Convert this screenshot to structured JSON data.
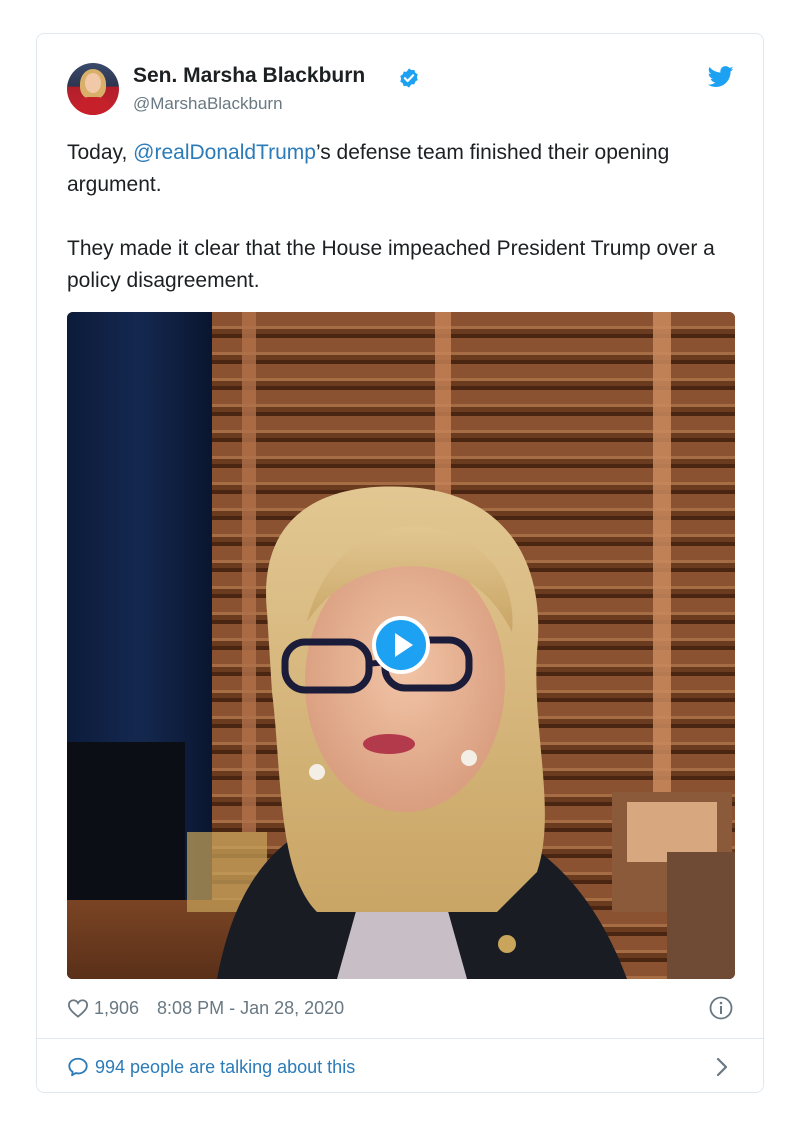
{
  "tweet": {
    "author_name": "Sen. Marsha Blackburn",
    "author_handle": "@MarshaBlackburn",
    "text_line1_before": "Today, ",
    "mention": "@realDonaldTrump",
    "text_line1_after": "’s defense team finished their opening argument.",
    "text_paragraph2": "They made it clear that the House impeached President Trump over a policy disagreement.",
    "likes": "1,906",
    "timestamp": "8:08 PM - Jan 28, 2020",
    "talking": "994 people are talking about this"
  },
  "icons": {
    "verified": "verified-badge-icon",
    "twitter": "twitter-bird-icon",
    "play": "play-icon",
    "heart": "heart-icon",
    "info": "info-icon",
    "comment": "comment-bubble-icon",
    "chevron": "chevron-right-icon"
  },
  "colors": {
    "link": "#2b7bb9",
    "verified": "#1da1f2",
    "muted": "#697882",
    "border": "#e1e8ed"
  }
}
